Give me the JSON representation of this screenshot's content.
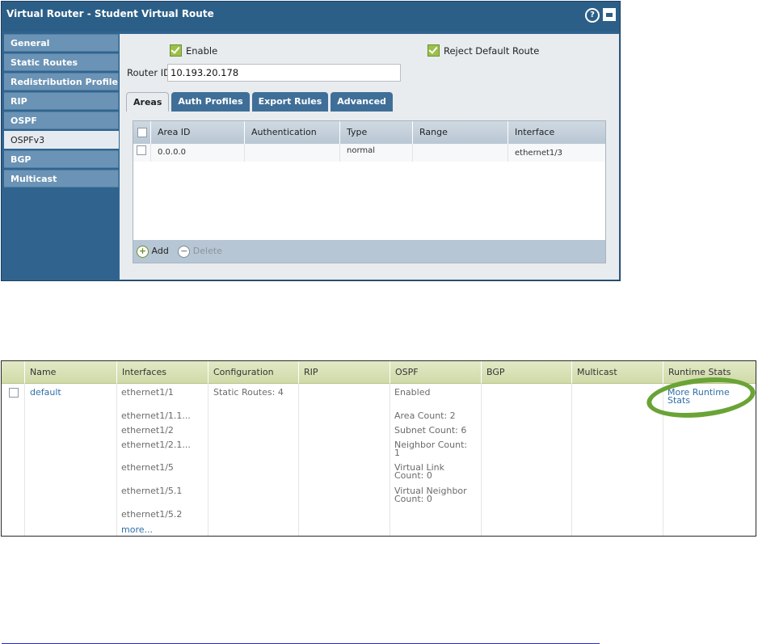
{
  "dialog": {
    "title": "Virtual Router - Student Virtual Route",
    "help_glyph": "?",
    "sidebar": [
      "General",
      "Static Routes",
      "Redistribution Profile",
      "RIP",
      "OSPF",
      "OSPFv3",
      "BGP",
      "Multicast"
    ],
    "active_sidebar": "OSPFv3",
    "enable_label": "Enable",
    "enable_checked": true,
    "reject_default_label": "Reject Default Route",
    "reject_default_checked": true,
    "router_id_label": "Router ID",
    "router_id_value": "10.193.20.178",
    "tabs": [
      "Areas",
      "Auth Profiles",
      "Export Rules",
      "Advanced"
    ],
    "active_tab": "Areas",
    "grid": {
      "headers": [
        "Area ID",
        "Authentication",
        "Type",
        "Range",
        "Interface"
      ],
      "rows": [
        {
          "area_id": "0.0.0.0",
          "authentication": "",
          "type": "normal",
          "range": "",
          "interface": "ethernet1/3"
        }
      ]
    },
    "add_label": "Add",
    "delete_label": "Delete"
  },
  "router_table": {
    "headers": [
      "Name",
      "Interfaces",
      "Configuration",
      "RIP",
      "OSPF",
      "BGP",
      "Multicast",
      "Runtime Stats"
    ],
    "name": "default",
    "interfaces": [
      "ethernet1/1",
      "ethernet1/1.1...",
      "ethernet1/2",
      "ethernet1/2.1...",
      "ethernet1/5",
      "ethernet1/5.1",
      "ethernet1/5.2"
    ],
    "more_link": "more...",
    "configuration": "Static Routes: 4",
    "ospf": {
      "status": "Enabled",
      "area_count": "Area Count: 2",
      "subnet_count": "Subnet Count: 6",
      "neighbor_count_1": "Neighbor Count:",
      "neighbor_count_2": "1",
      "virtual_link_1": "Virtual Link",
      "virtual_link_2": "Count: 0",
      "virtual_neighbor_1": "Virtual Neighbor",
      "virtual_neighbor_2": "Count: 0"
    },
    "runtime_link_1": "More Runtime",
    "runtime_link_2": "Stats",
    "highlight_color": "#6aa336"
  }
}
